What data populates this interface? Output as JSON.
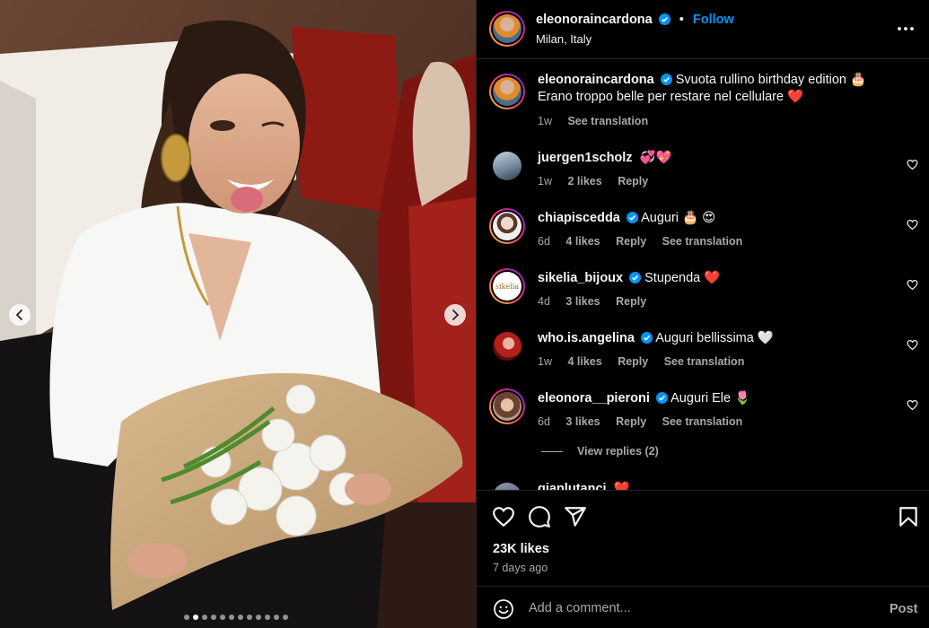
{
  "post": {
    "username": "eleonoraincardona",
    "follow_label": "Follow",
    "separator": "•",
    "location": "Milan, Italy",
    "caption_line1": "Svuota rullino birthday edition 🎂",
    "caption_line2": "Erano troppo belle per restare nel cellulare ❤️",
    "caption_time": "1w",
    "caption_see_translation": "See translation",
    "likes": "23K likes",
    "date": "7 days ago",
    "carousel": {
      "total": 12,
      "active_index": 1
    }
  },
  "comments": [
    {
      "username": "juergen1scholz",
      "verified": false,
      "text": "💞💖",
      "time": "1w",
      "likes": "2 likes",
      "reply": "Reply",
      "translation": ""
    },
    {
      "username": "chiapiscedda",
      "verified": true,
      "text": "Auguri 🎂 😍",
      "time": "6d",
      "likes": "4 likes",
      "reply": "Reply",
      "translation": "See translation"
    },
    {
      "username": "sikelia_bijoux",
      "verified": true,
      "text": "Stupenda ❤️",
      "time": "4d",
      "likes": "3 likes",
      "reply": "Reply",
      "translation": ""
    },
    {
      "username": "who.is.angelina",
      "verified": true,
      "text": "Auguri bellissima 🤍",
      "time": "1w",
      "likes": "4 likes",
      "reply": "Reply",
      "translation": "See translation"
    },
    {
      "username": "eleonora__pieroni",
      "verified": true,
      "text": "Auguri Ele 🌷",
      "time": "6d",
      "likes": "3 likes",
      "reply": "Reply",
      "translation": "See translation"
    },
    {
      "username": "gianlutanci",
      "verified": false,
      "text": "❤️",
      "time": "",
      "likes": "",
      "reply": "",
      "translation": ""
    }
  ],
  "view_replies": "View replies (2)",
  "add_comment": {
    "placeholder": "Add a comment...",
    "post_label": "Post"
  },
  "colors": {
    "accent": "#0095f6",
    "verified": "#0095f6",
    "secondary_text": "#a8a8a8",
    "background": "#000000"
  },
  "icons": {
    "header": [
      "verified-badge-icon",
      "more-options-icon"
    ],
    "actions": [
      "heart-icon",
      "comment-icon",
      "share-icon",
      "bookmark-icon"
    ],
    "photo": [
      "chevron-left-icon",
      "chevron-right-icon"
    ],
    "comment_box": [
      "emoji-icon"
    ]
  }
}
